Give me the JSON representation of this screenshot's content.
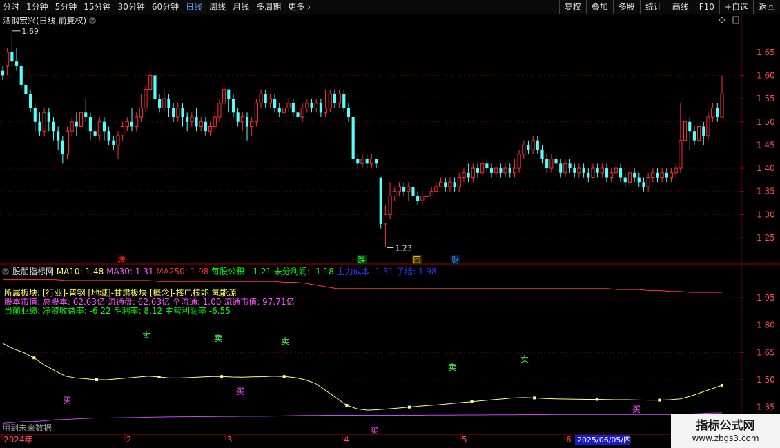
{
  "toolbar": {
    "periods": [
      "分时",
      "1分钟",
      "5分钟",
      "15分钟",
      "30分钟",
      "60分钟",
      "日线",
      "周线",
      "月线",
      "多周期"
    ],
    "active_period": "日线",
    "more_label": "更多",
    "right_buttons": [
      "复权",
      "叠加",
      "多股",
      "统计",
      "画线",
      "F10",
      "+自选",
      "返回"
    ]
  },
  "main_panel": {
    "title": "酒钢宏兴(日线,前复权)",
    "high_label": "1.69",
    "low_label": "1.23",
    "price_ticks": [
      "1.65",
      "1.60",
      "1.55",
      "1.50",
      "1.45",
      "1.40",
      "1.35",
      "1.30",
      "1.25"
    ],
    "event_markers": [
      {
        "text": "增",
        "color": "#ff4040",
        "bg": "#3a0000"
      },
      {
        "text": "跌",
        "color": "#40ff40",
        "bg": "#003a00"
      },
      {
        "text": "回",
        "color": "#ffcc00",
        "bg": "#3a2a00"
      },
      {
        "text": "财",
        "color": "#4da6ff",
        "bg": "#001a3a"
      }
    ]
  },
  "indicator_panel": {
    "name": "股朋指标网",
    "params": [
      {
        "label": "MA10: 1.48",
        "color": "#ffff55"
      },
      {
        "label": "MA30: 1.31",
        "color": "#ff55ff"
      },
      {
        "label": "MA250: 1.98",
        "color": "#ff3333"
      },
      {
        "label": "每股公积: -1.21",
        "color": "#00ff00"
      },
      {
        "label": "未分利润: -1.18",
        "color": "#00ff00"
      },
      {
        "label": "主力成本: 1.31",
        "color": "#3333ff"
      },
      {
        "label": "了结: 1.98",
        "color": "#3333ff"
      }
    ],
    "info_lines": [
      {
        "text": "所属板块: [行业]-普钢 [地域]-甘肃板块 [概念]-核电核能 氢能源",
        "color": "#ffff55"
      },
      {
        "text": "股本市值: 总股本: 62.63亿 流通盘: 62.63亿 全流通: 1.00 流通市值: 97.71亿",
        "color": "#ff55ff"
      },
      {
        "text": "当前业绩: 净资收益率: -6.22 毛利率: 8.12 主营利润率 -6.55",
        "color": "#00ff00"
      }
    ],
    "ticks": [
      "1.95",
      "1.80",
      "1.65",
      "1.50",
      "1.35"
    ],
    "sell_label": "卖",
    "buy_label": "买",
    "future_note": "用到未来数据"
  },
  "time_axis": {
    "labels": [
      "2024年",
      "2",
      "3",
      "4",
      "5",
      "6"
    ],
    "cursor_date": "2025/06/05/四"
  },
  "watermark": {
    "line1": "指标公式网",
    "line2": "www.zbgs3.com"
  },
  "colors": {
    "up": "#ff3030",
    "down": "#54ffff",
    "grid": "#7a0000",
    "ma10": "#ffff80",
    "ma30": "#cc44ff",
    "ma250": "#ff3333"
  },
  "chart_data": {
    "type": "candlestick",
    "y_range": [
      1.21,
      1.715
    ],
    "candles": [
      [
        1.61,
        1.6,
        1.62,
        1.59
      ],
      [
        1.62,
        1.65,
        1.66,
        1.6
      ],
      [
        1.65,
        1.63,
        1.69,
        1.62
      ],
      [
        1.63,
        1.62,
        1.66,
        1.61
      ],
      [
        1.62,
        1.58,
        1.62,
        1.57
      ],
      [
        1.58,
        1.56,
        1.58,
        1.55
      ],
      [
        1.56,
        1.53,
        1.57,
        1.52
      ],
      [
        1.53,
        1.5,
        1.54,
        1.48
      ],
      [
        1.5,
        1.48,
        1.52,
        1.47
      ],
      [
        1.48,
        1.52,
        1.53,
        1.47
      ],
      [
        1.52,
        1.5,
        1.53,
        1.48
      ],
      [
        1.5,
        1.48,
        1.51,
        1.46
      ],
      [
        1.48,
        1.46,
        1.49,
        1.44
      ],
      [
        1.46,
        1.43,
        1.47,
        1.41
      ],
      [
        1.43,
        1.48,
        1.49,
        1.42
      ],
      [
        1.48,
        1.5,
        1.51,
        1.47
      ],
      [
        1.5,
        1.49,
        1.52,
        1.47
      ],
      [
        1.49,
        1.52,
        1.53,
        1.48
      ],
      [
        1.52,
        1.51,
        1.55,
        1.5
      ],
      [
        1.51,
        1.48,
        1.52,
        1.46
      ],
      [
        1.48,
        1.47,
        1.49,
        1.45
      ],
      [
        1.47,
        1.5,
        1.51,
        1.46
      ],
      [
        1.5,
        1.48,
        1.51,
        1.46
      ],
      [
        1.48,
        1.46,
        1.49,
        1.45
      ],
      [
        1.46,
        1.45,
        1.47,
        1.44
      ],
      [
        1.45,
        1.47,
        1.48,
        1.42
      ],
      [
        1.47,
        1.49,
        1.5,
        1.46
      ],
      [
        1.49,
        1.5,
        1.51,
        1.48
      ],
      [
        1.5,
        1.49,
        1.53,
        1.48
      ],
      [
        1.49,
        1.51,
        1.52,
        1.48
      ],
      [
        1.51,
        1.53,
        1.56,
        1.5
      ],
      [
        1.53,
        1.57,
        1.58,
        1.52
      ],
      [
        1.57,
        1.6,
        1.61,
        1.55
      ],
      [
        1.6,
        1.55,
        1.6,
        1.53
      ],
      [
        1.55,
        1.53,
        1.56,
        1.52
      ],
      [
        1.53,
        1.55,
        1.57,
        1.52
      ],
      [
        1.55,
        1.53,
        1.56,
        1.51
      ],
      [
        1.53,
        1.51,
        1.54,
        1.5
      ],
      [
        1.51,
        1.53,
        1.54,
        1.5
      ],
      [
        1.53,
        1.51,
        1.54,
        1.49
      ],
      [
        1.51,
        1.5,
        1.52,
        1.48
      ],
      [
        1.5,
        1.51,
        1.52,
        1.49
      ],
      [
        1.51,
        1.49,
        1.53,
        1.48
      ],
      [
        1.49,
        1.5,
        1.51,
        1.48
      ],
      [
        1.5,
        1.48,
        1.51,
        1.47
      ],
      [
        1.48,
        1.49,
        1.5,
        1.47
      ],
      [
        1.49,
        1.51,
        1.52,
        1.48
      ],
      [
        1.51,
        1.54,
        1.55,
        1.5
      ],
      [
        1.54,
        1.57,
        1.58,
        1.53
      ],
      [
        1.57,
        1.55,
        1.57,
        1.52
      ],
      [
        1.55,
        1.52,
        1.56,
        1.51
      ],
      [
        1.52,
        1.5,
        1.53,
        1.49
      ],
      [
        1.5,
        1.51,
        1.52,
        1.48
      ],
      [
        1.51,
        1.49,
        1.52,
        1.46
      ],
      [
        1.49,
        1.5,
        1.51,
        1.47
      ],
      [
        1.5,
        1.54,
        1.55,
        1.49
      ],
      [
        1.54,
        1.56,
        1.57,
        1.53
      ],
      [
        1.56,
        1.54,
        1.57,
        1.53
      ],
      [
        1.54,
        1.55,
        1.56,
        1.53
      ],
      [
        1.55,
        1.53,
        1.56,
        1.52
      ],
      [
        1.53,
        1.52,
        1.54,
        1.51
      ],
      [
        1.52,
        1.53,
        1.54,
        1.51
      ],
      [
        1.53,
        1.54,
        1.55,
        1.52
      ],
      [
        1.54,
        1.52,
        1.55,
        1.51
      ],
      [
        1.52,
        1.51,
        1.53,
        1.5
      ],
      [
        1.51,
        1.53,
        1.54,
        1.5
      ],
      [
        1.53,
        1.54,
        1.55,
        1.52
      ],
      [
        1.54,
        1.53,
        1.55,
        1.52
      ],
      [
        1.53,
        1.54,
        1.55,
        1.52
      ],
      [
        1.54,
        1.52,
        1.55,
        1.51
      ],
      [
        1.52,
        1.53,
        1.57,
        1.51
      ],
      [
        1.53,
        1.56,
        1.57,
        1.52
      ],
      [
        1.56,
        1.54,
        1.57,
        1.53
      ],
      [
        1.54,
        1.56,
        1.57,
        1.53
      ],
      [
        1.56,
        1.53,
        1.57,
        1.52
      ],
      [
        1.53,
        1.51,
        1.54,
        1.5
      ],
      [
        1.51,
        1.42,
        1.51,
        1.41
      ],
      [
        1.42,
        1.41,
        1.43,
        1.4
      ],
      [
        1.41,
        1.42,
        1.43,
        1.4
      ],
      [
        1.42,
        1.41,
        1.43,
        1.4
      ],
      [
        1.41,
        1.42,
        1.43,
        1.4
      ],
      [
        1.42,
        1.41,
        1.42,
        1.4
      ],
      [
        1.38,
        1.28,
        1.38,
        1.27
      ],
      [
        1.28,
        1.3,
        1.32,
        1.23
      ],
      [
        1.3,
        1.34,
        1.37,
        1.29
      ],
      [
        1.34,
        1.35,
        1.36,
        1.33
      ],
      [
        1.35,
        1.36,
        1.37,
        1.34
      ],
      [
        1.36,
        1.35,
        1.37,
        1.34
      ],
      [
        1.35,
        1.36,
        1.37,
        1.33
      ],
      [
        1.36,
        1.34,
        1.37,
        1.33
      ],
      [
        1.34,
        1.33,
        1.35,
        1.32
      ],
      [
        1.33,
        1.34,
        1.35,
        1.32
      ],
      [
        1.34,
        1.34,
        1.35,
        1.33
      ],
      [
        1.34,
        1.35,
        1.36,
        1.34
      ],
      [
        1.35,
        1.36,
        1.37,
        1.35
      ],
      [
        1.36,
        1.37,
        1.38,
        1.36
      ],
      [
        1.37,
        1.36,
        1.38,
        1.35
      ],
      [
        1.36,
        1.37,
        1.38,
        1.35
      ],
      [
        1.37,
        1.36,
        1.38,
        1.35
      ],
      [
        1.36,
        1.38,
        1.39,
        1.35
      ],
      [
        1.38,
        1.39,
        1.4,
        1.37
      ],
      [
        1.39,
        1.38,
        1.41,
        1.37
      ],
      [
        1.38,
        1.4,
        1.41,
        1.37
      ],
      [
        1.4,
        1.39,
        1.41,
        1.38
      ],
      [
        1.39,
        1.41,
        1.42,
        1.38
      ],
      [
        1.41,
        1.4,
        1.42,
        1.39
      ],
      [
        1.4,
        1.39,
        1.41,
        1.38
      ],
      [
        1.39,
        1.4,
        1.41,
        1.38
      ],
      [
        1.4,
        1.39,
        1.41,
        1.38
      ],
      [
        1.39,
        1.4,
        1.41,
        1.38
      ],
      [
        1.4,
        1.39,
        1.41,
        1.38
      ],
      [
        1.39,
        1.4,
        1.42,
        1.38
      ],
      [
        1.4,
        1.43,
        1.44,
        1.39
      ],
      [
        1.43,
        1.45,
        1.46,
        1.42
      ],
      [
        1.45,
        1.44,
        1.46,
        1.43
      ],
      [
        1.44,
        1.46,
        1.47,
        1.43
      ],
      [
        1.46,
        1.44,
        1.47,
        1.43
      ],
      [
        1.44,
        1.42,
        1.45,
        1.41
      ],
      [
        1.42,
        1.4,
        1.43,
        1.39
      ],
      [
        1.4,
        1.42,
        1.43,
        1.39
      ],
      [
        1.42,
        1.41,
        1.43,
        1.4
      ],
      [
        1.41,
        1.39,
        1.42,
        1.38
      ],
      [
        1.39,
        1.41,
        1.42,
        1.38
      ],
      [
        1.41,
        1.4,
        1.42,
        1.39
      ],
      [
        1.4,
        1.39,
        1.41,
        1.38
      ],
      [
        1.39,
        1.4,
        1.41,
        1.38
      ],
      [
        1.4,
        1.39,
        1.41,
        1.38
      ],
      [
        1.39,
        1.38,
        1.4,
        1.37
      ],
      [
        1.38,
        1.4,
        1.41,
        1.38
      ],
      [
        1.4,
        1.39,
        1.41,
        1.38
      ],
      [
        1.39,
        1.4,
        1.41,
        1.38
      ],
      [
        1.4,
        1.38,
        1.41,
        1.37
      ],
      [
        1.38,
        1.39,
        1.4,
        1.37
      ],
      [
        1.39,
        1.4,
        1.41,
        1.38
      ],
      [
        1.4,
        1.38,
        1.41,
        1.37
      ],
      [
        1.38,
        1.37,
        1.39,
        1.36
      ],
      [
        1.37,
        1.39,
        1.4,
        1.36
      ],
      [
        1.39,
        1.38,
        1.4,
        1.37
      ],
      [
        1.38,
        1.37,
        1.39,
        1.36
      ],
      [
        1.37,
        1.36,
        1.38,
        1.35
      ],
      [
        1.36,
        1.38,
        1.39,
        1.35
      ],
      [
        1.38,
        1.39,
        1.4,
        1.37
      ],
      [
        1.39,
        1.38,
        1.4,
        1.37
      ],
      [
        1.38,
        1.39,
        1.4,
        1.37
      ],
      [
        1.39,
        1.38,
        1.4,
        1.37
      ],
      [
        1.38,
        1.39,
        1.4,
        1.37
      ],
      [
        1.39,
        1.4,
        1.41,
        1.38
      ],
      [
        1.4,
        1.46,
        1.54,
        1.39
      ],
      [
        1.46,
        1.5,
        1.52,
        1.43
      ],
      [
        1.5,
        1.48,
        1.51,
        1.44
      ],
      [
        1.48,
        1.46,
        1.49,
        1.45
      ],
      [
        1.46,
        1.49,
        1.5,
        1.45
      ],
      [
        1.49,
        1.47,
        1.5,
        1.45
      ],
      [
        1.47,
        1.51,
        1.52,
        1.46
      ],
      [
        1.51,
        1.53,
        1.54,
        1.5
      ],
      [
        1.53,
        1.51,
        1.54,
        1.5
      ],
      [
        1.51,
        1.56,
        1.6,
        1.51
      ]
    ],
    "ind_y_range": [
      1.22,
      2.09
    ],
    "ma10": [
      1.7,
      1.67,
      1.65,
      1.62,
      1.58,
      1.55,
      1.52,
      1.51,
      1.505,
      1.5,
      1.5,
      1.505,
      1.51,
      1.515,
      1.52,
      1.515,
      1.51,
      1.51,
      1.512,
      1.515,
      1.518,
      1.518,
      1.515,
      1.514,
      1.516,
      1.517,
      1.52,
      1.518,
      1.512,
      1.5,
      1.48,
      1.44,
      1.4,
      1.36,
      1.34,
      1.333,
      1.336,
      1.34,
      1.345,
      1.35,
      1.355,
      1.36,
      1.364,
      1.37,
      1.375,
      1.38,
      1.385,
      1.39,
      1.395,
      1.4,
      1.402,
      1.4,
      1.397,
      1.395,
      1.394,
      1.393,
      1.392,
      1.392,
      1.391,
      1.39,
      1.39,
      1.389,
      1.388,
      1.388,
      1.39,
      1.395,
      1.41,
      1.43,
      1.45,
      1.47
    ],
    "ma30": [
      1.26,
      1.265,
      1.27,
      1.27,
      1.275,
      1.28,
      1.282,
      1.285,
      1.288,
      1.29,
      1.29,
      1.291,
      1.292,
      1.293,
      1.294,
      1.295,
      1.296,
      1.297,
      1.297,
      1.298,
      1.298,
      1.299,
      1.299,
      1.3,
      1.3,
      1.3,
      1.301,
      1.302,
      1.303,
      1.304,
      1.304,
      1.305,
      1.305,
      1.305,
      1.305,
      1.305,
      1.305,
      1.305,
      1.305,
      1.305,
      1.305,
      1.306,
      1.306,
      1.306,
      1.307,
      1.307,
      1.307,
      1.308,
      1.308,
      1.308,
      1.309,
      1.309,
      1.309,
      1.31,
      1.31,
      1.31,
      1.31,
      1.31,
      1.31,
      1.31,
      1.31,
      1.31,
      1.31,
      1.31,
      1.31,
      1.31,
      1.312,
      1.315,
      1.318,
      1.318
    ],
    "ma250": [
      2.05,
      2.05,
      2.05,
      2.05,
      2.05,
      2.05,
      2.045,
      2.045,
      2.045,
      2.045,
      2.045,
      2.045,
      2.045,
      2.045,
      2.045,
      2.04,
      2.04,
      2.04,
      2.04,
      2.04,
      2.04,
      2.04,
      2.04,
      2.04,
      2.04,
      2.04,
      2.04,
      2.035,
      2.035,
      2.03,
      2.02,
      2.01,
      2.0,
      2.0,
      2.0,
      2.0,
      2.0,
      2.0,
      2.0,
      2.0,
      2.0,
      2.0,
      2.0,
      2.0,
      2.0,
      2.0,
      2.0,
      2.0,
      2.0,
      2.0,
      2.0,
      2.0,
      2.0,
      2.0,
      2.0,
      2.0,
      2.0,
      2.0,
      2.0,
      1.995,
      1.995,
      1.995,
      1.99,
      1.99,
      1.985,
      1.985,
      1.98,
      1.98,
      1.98,
      1.98
    ]
  }
}
